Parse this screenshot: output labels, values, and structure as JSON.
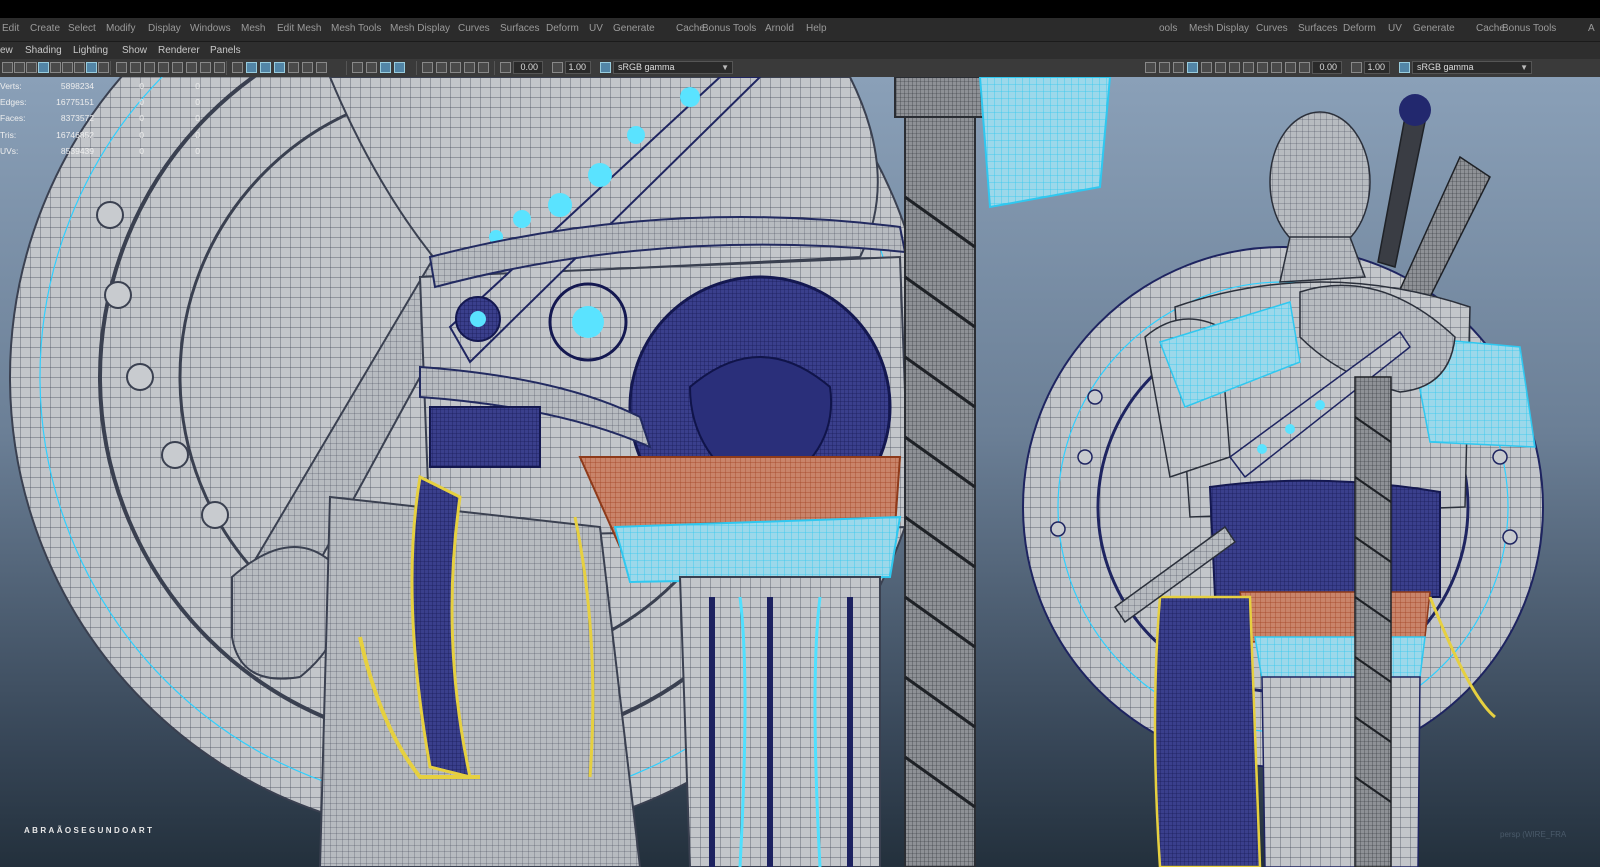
{
  "app": {
    "menus_left": [
      "Edit",
      "Create",
      "Select",
      "Modify",
      "Display",
      "Windows",
      "Mesh",
      "Edit Mesh",
      "Mesh Tools",
      "Mesh Display",
      "Curves",
      "Surfaces",
      "Deform",
      "UV",
      "Generate",
      "Cache",
      "Bonus Tools",
      "Arnold",
      "Help"
    ],
    "menus_right": [
      "ools",
      "Mesh Display",
      "Curves",
      "Surfaces",
      "Deform",
      "UV",
      "Generate",
      "Cache",
      "Bonus Tools",
      "A"
    ]
  },
  "panel_menu": [
    "ew",
    "Shading",
    "Lighting",
    "Show",
    "Renderer",
    "Panels"
  ],
  "toolbar_left": {
    "exposure": "0.00",
    "gamma": "1.00",
    "color_space": "sRGB gamma"
  },
  "toolbar_right": {
    "exposure": "0.00",
    "gamma": "1.00",
    "color_space": "sRGB gamma"
  },
  "hud": [
    {
      "label": "Verts:",
      "v1": "5898234",
      "v2": "0",
      "v3": "0"
    },
    {
      "label": "Edges:",
      "v1": "16775151",
      "v2": "0",
      "v3": "0"
    },
    {
      "label": "Faces:",
      "v1": "8373572",
      "v2": "0",
      "v3": "0"
    },
    {
      "label": "Tris:",
      "v1": "16746852",
      "v2": "0",
      "v3": "0"
    },
    {
      "label": "UVs:",
      "v1": "8539439",
      "v2": "0",
      "v3": "0"
    }
  ],
  "watermark": "ABRAÃOSEGUNDOART",
  "camera_label": "persp (WIRE_FRA",
  "colors": {
    "wire_gray": "#b9bcc0",
    "wire_dark": "#22286e",
    "selection_cyan": "#4fe0ff",
    "fur_yellow": "#e6d040",
    "leather_orange": "#c0603a",
    "highlight_icon": "#5285a6"
  }
}
